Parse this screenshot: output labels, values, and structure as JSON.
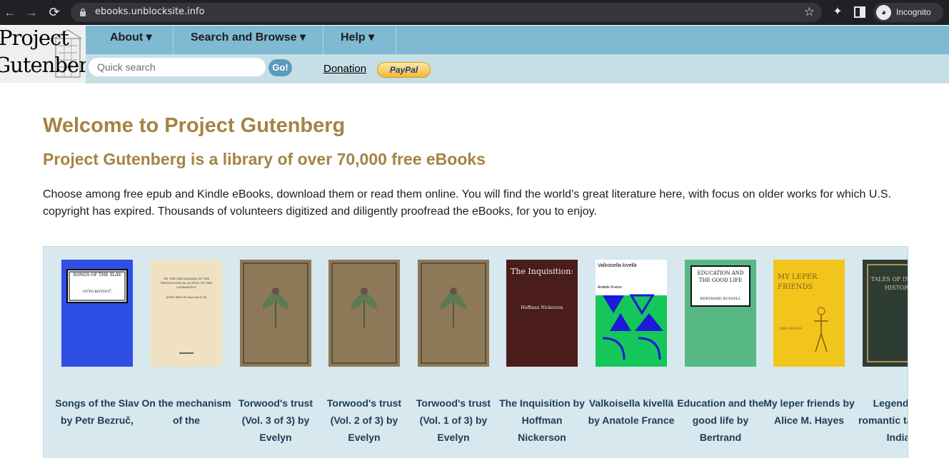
{
  "browser": {
    "url": "ebooks.unblocksite.info",
    "profile_label": "Incognito"
  },
  "site": {
    "logo_text_line1": "Project",
    "logo_text_line2": "Gutenberg",
    "menu": [
      {
        "label": "About ▾"
      },
      {
        "label": "Search and Browse ▾"
      },
      {
        "label": "Help ▾"
      }
    ],
    "search": {
      "placeholder": "Quick search",
      "go_label": "Go!"
    },
    "donation_label": "Donation",
    "paypal_label": "PayPal"
  },
  "main": {
    "title": "Welcome to Project Gutenberg",
    "subtitle": "Project Gutenberg is a library of over 70,000 free eBooks",
    "intro": "Choose among free epub and Kindle eBooks, download them or read them online. You will find the world’s great literature here, with focus on older works for which U.S. copyright has expired. Thousands of volunteers digitized and diligently proofread the eBooks, for you to enjoy."
  },
  "books": [
    {
      "title": "Songs of the Slav by Petr Bezruč,",
      "cover_text": "SONGS OF THE SLAV",
      "cover_sub": "OTTO KOTOUČ",
      "cover_color": "#2f4ee6"
    },
    {
      "title": "On the mechanism of the",
      "cover_text": "ON THE MECHANISM OF THE PHYSIOLOGICAL ACTION OF THE CATHARTICS",
      "cover_sub": "JOHN BRUCE MacCALLUM",
      "cover_color": "#efe1c2"
    },
    {
      "title": "Torwood's trust (Vol. 3 of 3) by Evelyn",
      "cover_text": "",
      "cover_sub": "",
      "cover_color": "#8d7858"
    },
    {
      "title": "Torwood's trust (Vol. 2 of 3) by Evelyn",
      "cover_text": "",
      "cover_sub": "",
      "cover_color": "#8d7858"
    },
    {
      "title": "Torwood's trust (Vol. 1 of 3) by Evelyn",
      "cover_text": "",
      "cover_sub": "",
      "cover_color": "#8d7858"
    },
    {
      "title": "The Inquisition by Hoffman Nickerson",
      "cover_text": "The Inquisition:",
      "cover_sub": "Hoffman Nickerson",
      "cover_color": "#4a1c1c"
    },
    {
      "title": "Valkoisella kivellä by Anatole France",
      "cover_text": "Valkoisella kivellä",
      "cover_sub": "Anatole France",
      "cover_color": "#15c65a"
    },
    {
      "title": "Education and the good life by Bertrand",
      "cover_text": "EDUCATION AND THE GOOD LIFE",
      "cover_sub": "BERTRAND RUSSELL",
      "cover_color": "#57b884"
    },
    {
      "title": "My leper friends by Alice M. Hayes",
      "cover_text": "MY LEPER FRIENDS",
      "cover_sub": "MRS HAYES",
      "cover_color": "#f2c51d"
    },
    {
      "title": "Legendary romantic tales of India",
      "cover_text": "TALES OF INDIAN HISTORY",
      "cover_sub": "",
      "cover_color": "#2e3d33"
    }
  ]
}
